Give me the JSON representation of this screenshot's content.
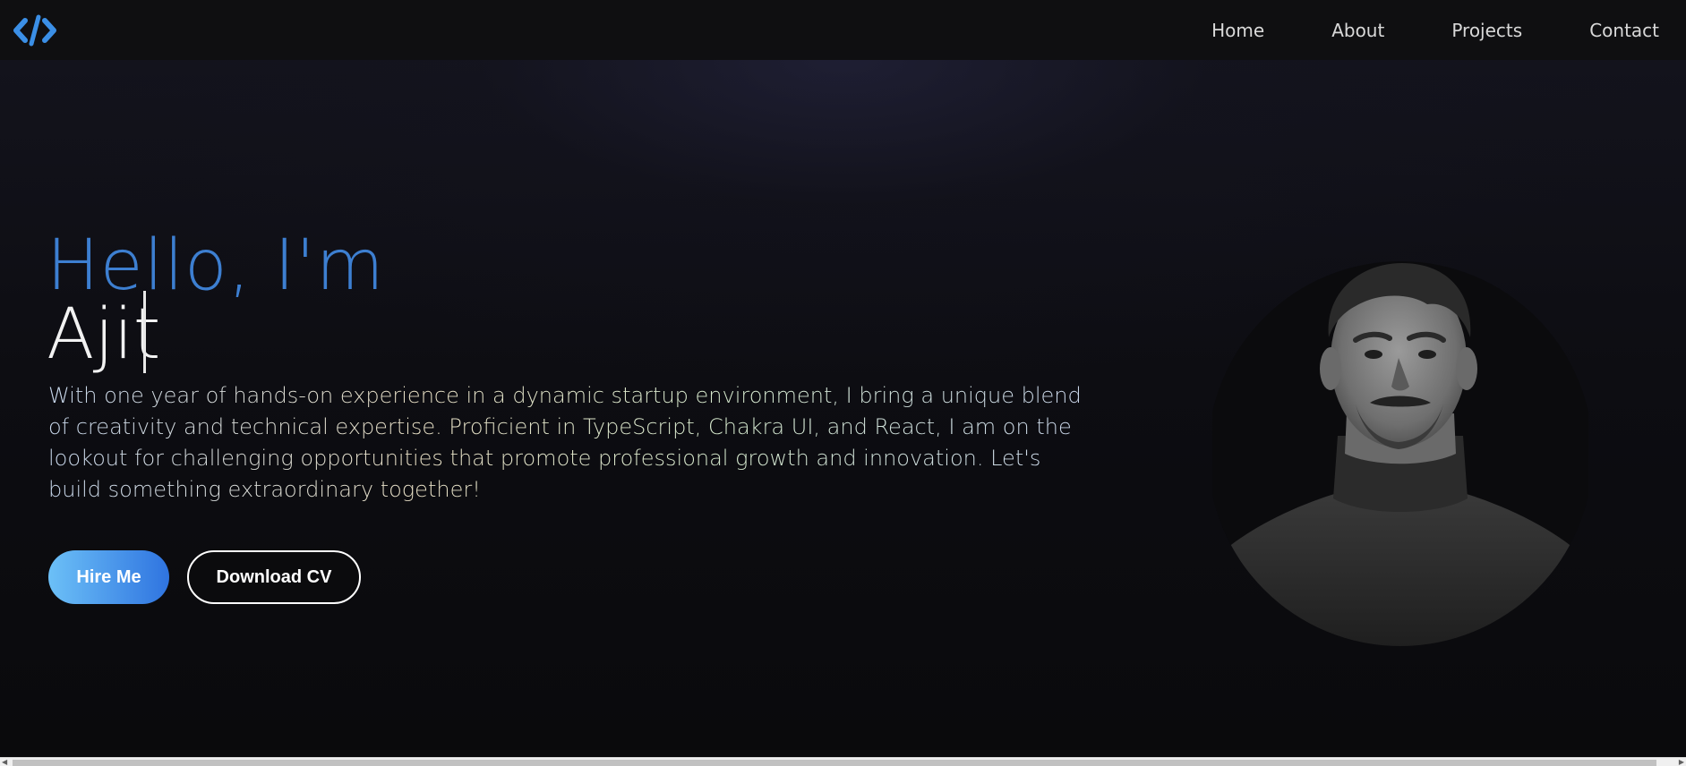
{
  "nav": {
    "logo_icon": "code-brackets-icon",
    "links": [
      "Home",
      "About",
      "Projects",
      "Contact"
    ]
  },
  "hero": {
    "greeting": "Hello, I'm",
    "name": "Ajit",
    "bio": "With one year of hands-on experience in a dynamic startup environment, I bring a unique blend of creativity and technical expertise. Proficient in TypeScript, Chakra UI, and React, I am on the lookout for challenging opportunities that promote professional growth and innovation. Let's build something extraordinary together!",
    "hire_label": "Hire Me",
    "cv_label": "Download CV"
  },
  "colors": {
    "accent": "#3d7fd1",
    "background": "#0b0b0d",
    "button_gradient_start": "#6cc0f7",
    "button_gradient_end": "#2f74e0"
  }
}
